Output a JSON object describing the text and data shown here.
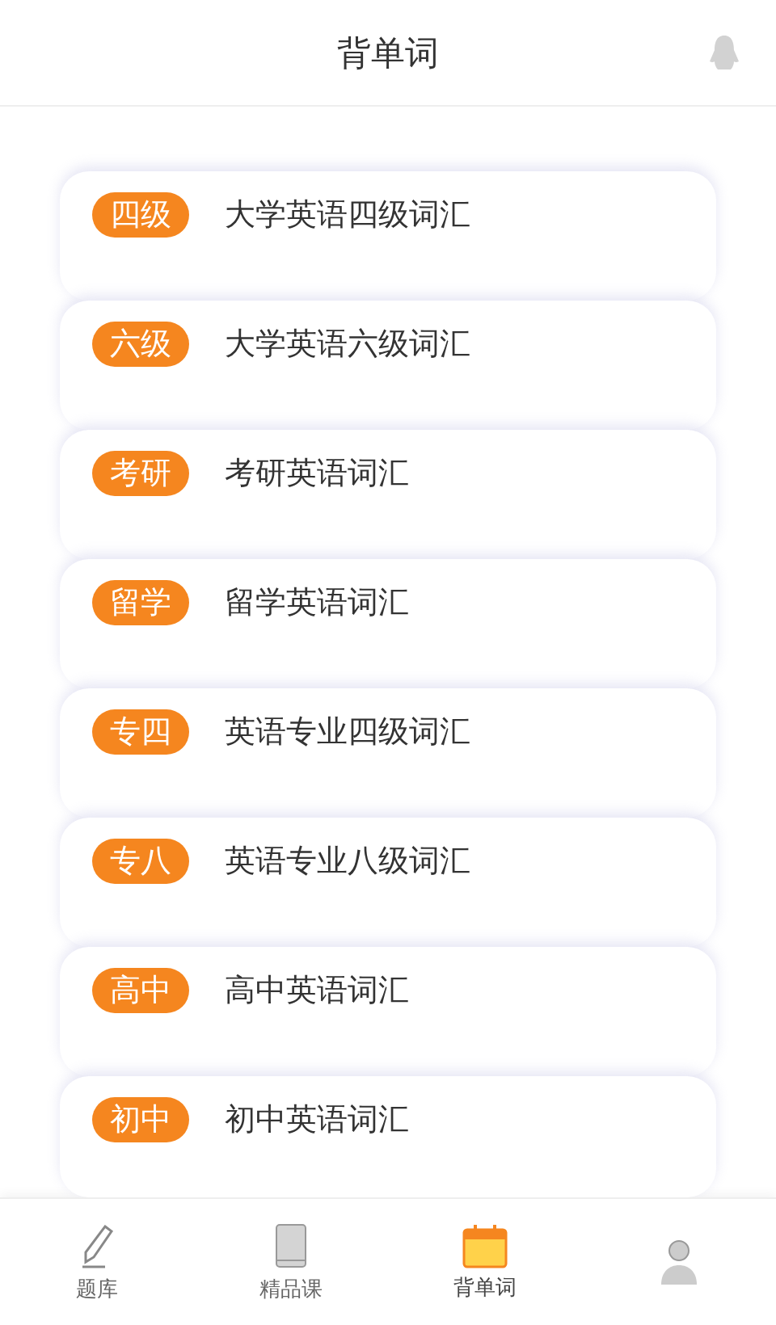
{
  "header": {
    "title": "背单词"
  },
  "cards": [
    {
      "badge": "四级",
      "title": "大学英语四级词汇"
    },
    {
      "badge": "六级",
      "title": "大学英语六级词汇"
    },
    {
      "badge": "考研",
      "title": "考研英语词汇"
    },
    {
      "badge": "留学",
      "title": "留学英语词汇"
    },
    {
      "badge": "专四",
      "title": "英语专业四级词汇"
    },
    {
      "badge": "专八",
      "title": "英语专业八级词汇"
    },
    {
      "badge": "高中",
      "title": "高中英语词汇"
    },
    {
      "badge": "初中",
      "title": "初中英语词汇"
    }
  ],
  "tabs": [
    {
      "kind": "pencil",
      "label": "题库",
      "selected": false
    },
    {
      "kind": "book",
      "label": "精品课",
      "selected": false
    },
    {
      "kind": "calendar",
      "label": "背单词",
      "selected": true
    },
    {
      "kind": "person",
      "selected": false
    }
  ]
}
